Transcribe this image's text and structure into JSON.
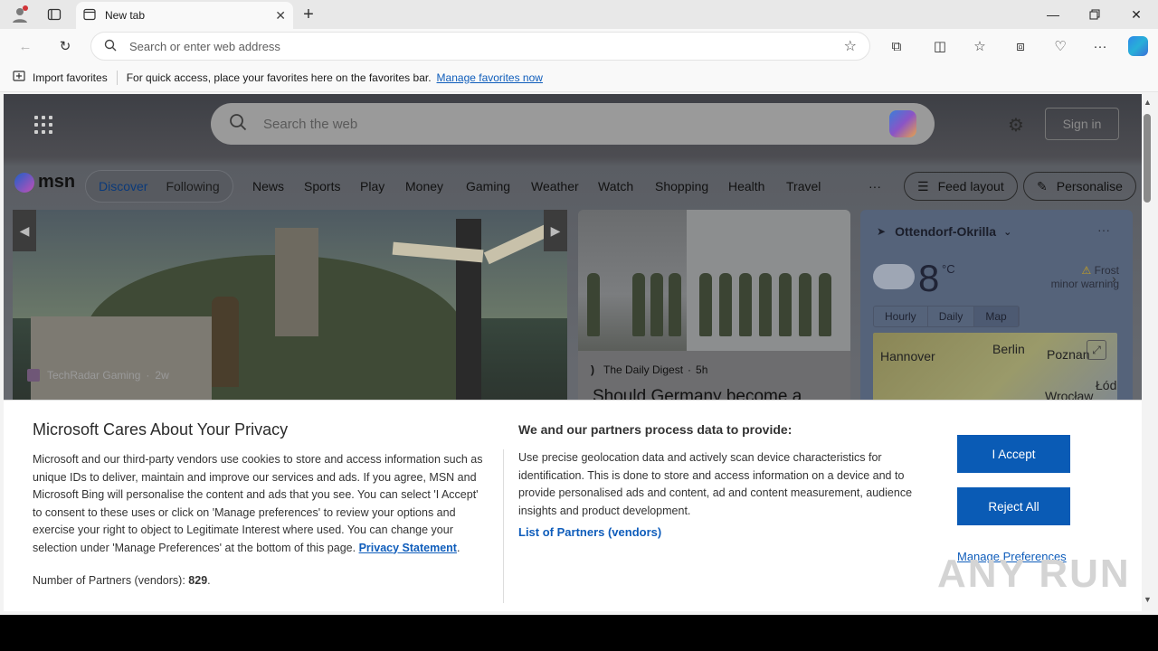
{
  "browser": {
    "tab_title": "New tab",
    "address_placeholder": "Search or enter web address"
  },
  "favorites_bar": {
    "import_label": "Import favorites",
    "message": "For quick access, place your favorites here on the favorites bar.",
    "manage_link": "Manage favorites now"
  },
  "msn": {
    "search_placeholder": "Search the web",
    "sign_in": "Sign in",
    "logo_text": "msn",
    "segments": [
      "Discover",
      "Following"
    ],
    "nav": [
      "News",
      "Sports",
      "Play",
      "Money",
      "Gaming",
      "Weather",
      "Watch",
      "Shopping",
      "Health",
      "Travel"
    ],
    "more": "···",
    "feed_layout": "Feed layout",
    "personalise": "Personalise"
  },
  "hero_card": {
    "source": "TechRadar Gaming",
    "age": "2w"
  },
  "news_card": {
    "source": "The Daily Digest",
    "age": "5h",
    "headline": "Should Germany become a"
  },
  "weather": {
    "location": "Ottendorf-Okrilla",
    "temperature": "8",
    "unit": "°C",
    "alert_title": "Frost",
    "alert_level": "minor warning",
    "tabs": [
      "Hourly",
      "Daily",
      "Map"
    ],
    "active_tab": "Map",
    "map_labels": [
      "Hannover",
      "Berlin",
      "Poznan",
      "Wrocław",
      "Łód"
    ]
  },
  "privacy": {
    "title": "Microsoft Cares About Your Privacy",
    "body": "Microsoft and our third-party vendors use cookies to store and access information such as unique IDs to deliver, maintain and improve our services and ads. If you agree, MSN and Microsoft Bing will personalise the content and ads that you see. You can select 'I Accept' to consent to these uses or click on 'Manage preferences' to review your options and exercise your right to object to Legitimate Interest where used.  You can change your selection under 'Manage Preferences' at the bottom of this page.",
    "privacy_link": "Privacy Statement",
    "partners_label": "Number of Partners (vendors):",
    "partners_count": "829",
    "right_title": "We and our partners process data to provide:",
    "right_body": "Use precise geolocation data and actively scan device characteristics for identification. This is done to store and access information on a device and to provide personalised ads and content, ad and content measurement, audience insights and product development.",
    "partners_list_link": "List of Partners (vendors)",
    "accept": "I Accept",
    "reject": "Reject All",
    "manage": "Manage Preferences"
  },
  "watermark": "ANY RUN"
}
